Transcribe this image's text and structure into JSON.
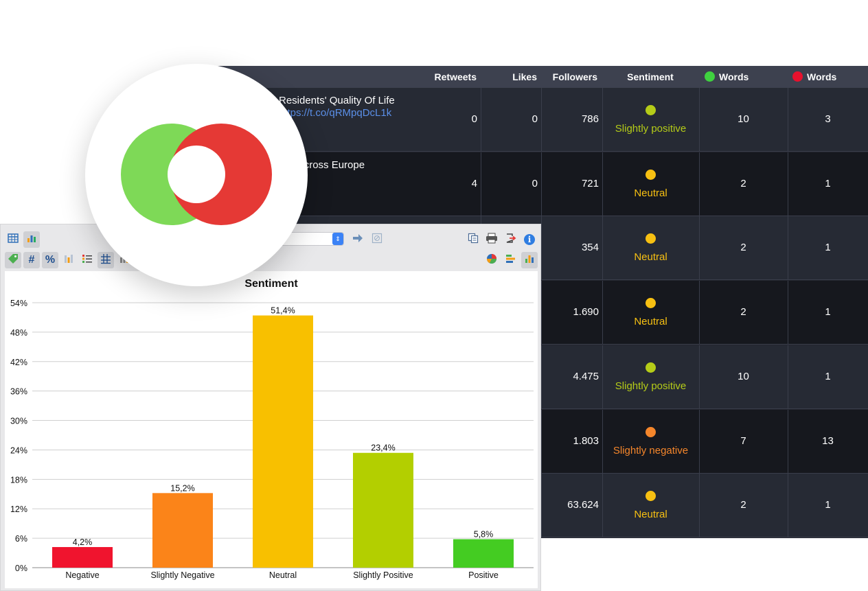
{
  "table": {
    "headers": {
      "retweets": "Retweets",
      "likes": "Likes",
      "followers": "Followers",
      "sentiment": "Sentiment",
      "positive_words": "Words",
      "negative_words": "Words"
    },
    "header_dot_colors": {
      "positive": "#3fd13f",
      "negative": "#e8112d"
    },
    "rows": [
      {
        "text_line1": "Residents' Quality Of Life",
        "text_line2": "https://t.co/qRMpqDcL1k",
        "retweets": "0",
        "likes": "0",
        "followers": "786",
        "sentiment": "Slightly positive",
        "sentiment_color": "#b5cc18",
        "pos_words": "10",
        "neg_words": "3"
      },
      {
        "text_line1": "tion across Europe",
        "text_line2": "",
        "retweets": "4",
        "likes": "0",
        "followers": "721",
        "sentiment": "Neutral",
        "sentiment_color": "#f7c012",
        "pos_words": "2",
        "neg_words": "1"
      },
      {
        "text_line1": "",
        "text_line2": "",
        "retweets": "",
        "likes": "",
        "followers": "354",
        "sentiment": "Neutral",
        "sentiment_color": "#f7c012",
        "pos_words": "2",
        "neg_words": "1"
      },
      {
        "text_line1": "",
        "text_line2": "",
        "retweets": "",
        "likes": "",
        "followers": "1.690",
        "sentiment": "Neutral",
        "sentiment_color": "#f7c012",
        "pos_words": "2",
        "neg_words": "1"
      },
      {
        "text_line1": "",
        "text_line2": "",
        "retweets": "",
        "likes": "",
        "followers": "4.475",
        "sentiment": "Slightly positive",
        "sentiment_color": "#b5cc18",
        "pos_words": "10",
        "neg_words": "1"
      },
      {
        "text_line1": "",
        "text_line2": "",
        "retweets": "",
        "likes": "",
        "followers": "1.803",
        "sentiment": "Slightly negative",
        "sentiment_color": "#f5862b",
        "pos_words": "7",
        "neg_words": "13"
      },
      {
        "text_line1": "",
        "text_line2": "",
        "retweets": "",
        "likes": "",
        "followers": "63.624",
        "sentiment": "Neutral",
        "sentiment_color": "#f7c012",
        "pos_words": "2",
        "neg_words": "1"
      }
    ]
  },
  "toolbar": {
    "icons": [
      "table-icon",
      "bar-chart-icon",
      "tag-icon",
      "hash-icon",
      "percent-icon",
      "column-settings-icon",
      "list-icon",
      "grid-icon",
      "bar-settings-icon",
      "arrow-right-icon",
      "clear-filter-icon",
      "copy-icon",
      "print-icon",
      "export-icon",
      "info-icon",
      "pie-chart-icon",
      "horizontal-bar-icon",
      "vertical-bar-icon"
    ],
    "hash_glyph": "#",
    "percent_glyph": "%",
    "info_glyph": "i"
  },
  "chart_data": {
    "type": "bar",
    "title": "Sentiment",
    "categories": [
      "Negative",
      "Slightly Negative",
      "Neutral",
      "Slightly Positive",
      "Positive"
    ],
    "values": [
      4.2,
      15.2,
      51.4,
      23.4,
      5.8
    ],
    "value_labels": [
      "4,2%",
      "15,2%",
      "51,4%",
      "23,4%",
      "5,8%"
    ],
    "colors": [
      "#f0142e",
      "#fb8419",
      "#f8c000",
      "#b3cf00",
      "#44cc22"
    ],
    "yticks": [
      0,
      6,
      12,
      18,
      24,
      30,
      36,
      42,
      48,
      54
    ],
    "ytick_labels": [
      "0%",
      "6%",
      "12%",
      "18%",
      "24%",
      "30%",
      "36%",
      "42%",
      "48%",
      "54%"
    ],
    "ylim": [
      0,
      54
    ],
    "grid": true
  },
  "logo": {
    "left_color": "#7ed957",
    "right_color": "#e53935"
  }
}
